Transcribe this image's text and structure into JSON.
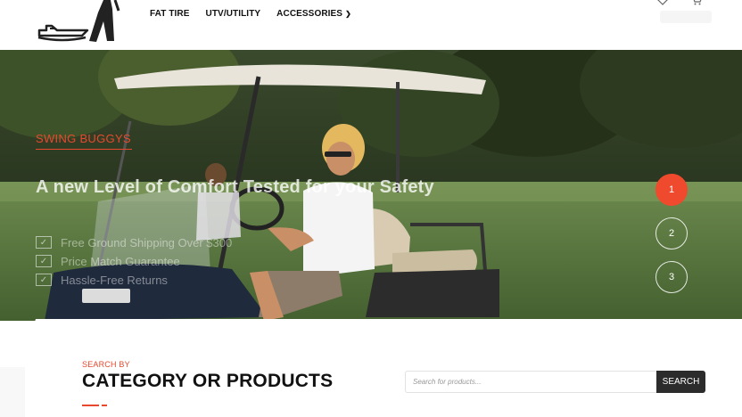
{
  "header": {
    "nav": [
      {
        "label": "FAT TIRE"
      },
      {
        "label": "UTV/UTILITY"
      },
      {
        "label": "ACCESSORIES",
        "has_dropdown": true
      }
    ],
    "icons": [
      "heart-icon",
      "cart-icon"
    ]
  },
  "hero": {
    "tag": "SWING BUGGYS",
    "title": "A new Level of Comfort Tested for your Safety",
    "features": [
      "Free Ground Shipping Over $300",
      "Price Match Guarantee",
      "Hassle-Free Returns"
    ],
    "slides": [
      "1",
      "2",
      "3"
    ],
    "active_slide": "1"
  },
  "section": {
    "eyebrow": "SEARCH BY",
    "title": "CATEGORY OR PRODUCTS"
  },
  "search": {
    "placeholder": "Search for products...",
    "button": "SEARCH"
  },
  "colors": {
    "accent": "#e8492e",
    "dark_button": "#2c2c2c"
  }
}
